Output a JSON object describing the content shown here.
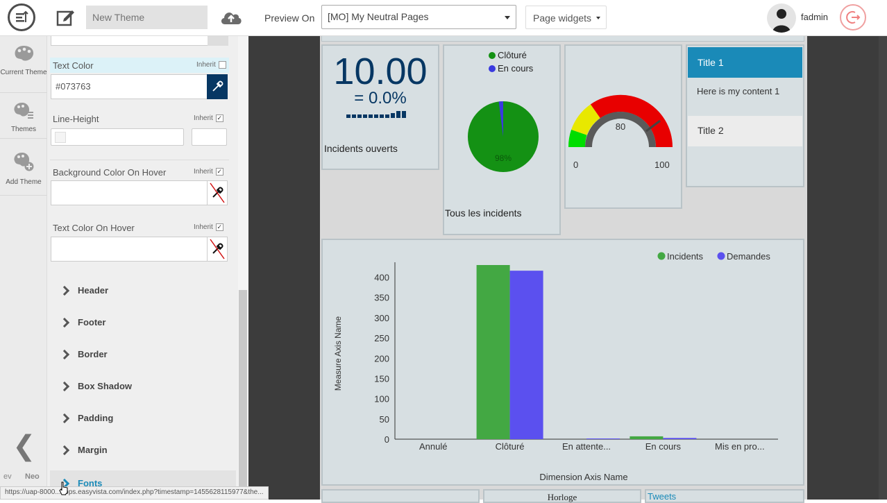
{
  "topbar": {
    "new_theme_placeholder": "New Theme",
    "preview_on_label": "Preview On",
    "preview_selected": "[MO] My Neutral Pages",
    "page_widgets_label": "Page widgets",
    "username": "fadmin"
  },
  "leftnav": {
    "items": [
      {
        "label": "Current Theme",
        "icon": "palette-icon"
      },
      {
        "label": "Themes",
        "icon": "palette-list-icon"
      },
      {
        "label": "Add Theme",
        "icon": "palette-add-icon"
      }
    ],
    "footer_left": "ev",
    "footer_right": "Neo"
  },
  "panel": {
    "text_color": {
      "label": "Text Color",
      "inherit_label": "Inherit",
      "inherit_checked": false,
      "value": "#073763"
    },
    "line_height": {
      "label": "Line-Height",
      "inherit_label": "Inherit",
      "inherit_checked": true
    },
    "bg_hover": {
      "label": "Background Color On Hover",
      "inherit_label": "Inherit",
      "inherit_checked": true,
      "value": ""
    },
    "text_hover": {
      "label": "Text Color On Hover",
      "inherit_label": "Inherit",
      "inherit_checked": true,
      "value": ""
    },
    "sections": [
      "Header",
      "Footer",
      "Border",
      "Box Shadow",
      "Padding",
      "Margin",
      "Fonts"
    ]
  },
  "status_url": "https://uap-8000...apps.easyvista.com/index.php?timestamp=1455628115977&the...",
  "widgets": {
    "kpi": {
      "value": "10.00",
      "change": "= 0.0%",
      "label": "Incidents ouverts",
      "color": "#073763"
    },
    "pie": {
      "legend": [
        "Clôturé",
        "En cours"
      ],
      "label": "Tous les incidents",
      "slice_label": "98%",
      "colors": [
        "#149114",
        "#3a3adf"
      ]
    },
    "gauge": {
      "value": 80,
      "min": 0,
      "max": 100,
      "value_label": "80",
      "min_label": "0",
      "max_label": "100"
    },
    "accordion": {
      "title1": "Title 1",
      "content1": "Here is my content 1",
      "title2": "Title 2",
      "accent": "#1a8ab8"
    },
    "bottom": {
      "clock_label": "Horloge",
      "tweets_label": "Tweets"
    }
  },
  "chart_data": {
    "type": "bar",
    "categories": [
      "Annulé",
      "Clôturé",
      "En attente...",
      "En cours",
      "Mis en pro..."
    ],
    "series": [
      {
        "name": "Incidents",
        "values": [
          0,
          430,
          0,
          7,
          0
        ],
        "color": "#43a843"
      },
      {
        "name": "Demandes",
        "values": [
          0,
          416,
          1,
          3,
          0
        ],
        "color": "#5b50ef"
      }
    ],
    "xlabel": "Dimension Axis Name",
    "ylabel": "Measure Axis Name",
    "ylim": [
      0,
      430
    ],
    "yticks": [
      0,
      50,
      100,
      150,
      200,
      250,
      300,
      350,
      400
    ],
    "legend_position": "top-right",
    "grid": false
  }
}
